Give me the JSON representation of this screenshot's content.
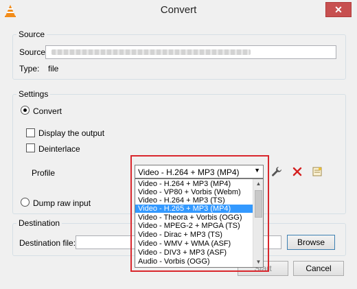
{
  "window": {
    "title": "Convert",
    "close_glyph": "✕"
  },
  "source": {
    "group_label": "Source",
    "source_label": "Source:",
    "type_label": "Type:",
    "type_value": "file"
  },
  "settings": {
    "group_label": "Settings",
    "convert_label": "Convert",
    "display_output_label": "Display the output",
    "deinterlace_label": "Deinterlace",
    "profile_label": "Profile",
    "profile_selected": "Video - H.264 + MP3 (MP4)",
    "dump_raw_label": "Dump raw input",
    "profile_options": [
      "Video - H.264 + MP3 (MP4)",
      "Video - VP80 + Vorbis (Webm)",
      "Video - H.264 + MP3 (TS)",
      "Video - H.265 + MP3 (MP4)",
      "Video - Theora + Vorbis (OGG)",
      "Video - MPEG-2 + MPGA (TS)",
      "Video - Dirac + MP3 (TS)",
      "Video - WMV + WMA (ASF)",
      "Video - DIV3 + MP3 (ASF)",
      "Audio - Vorbis (OGG)"
    ],
    "highlighted_option_index": 3
  },
  "destination": {
    "group_label": "Destination",
    "file_label": "Destination file:",
    "browse_label": "Browse"
  },
  "footer": {
    "start_label": "Start",
    "cancel_label": "Cancel"
  },
  "icons": {
    "app": "vlc-cone-icon",
    "edit_profile": "wrench-icon",
    "delete_profile": "red-x-icon",
    "new_profile": "new-profile-icon"
  },
  "colors": {
    "accent_selection": "#3399ff",
    "highlight_frame": "#d9262c",
    "close_button": "#c75050"
  }
}
